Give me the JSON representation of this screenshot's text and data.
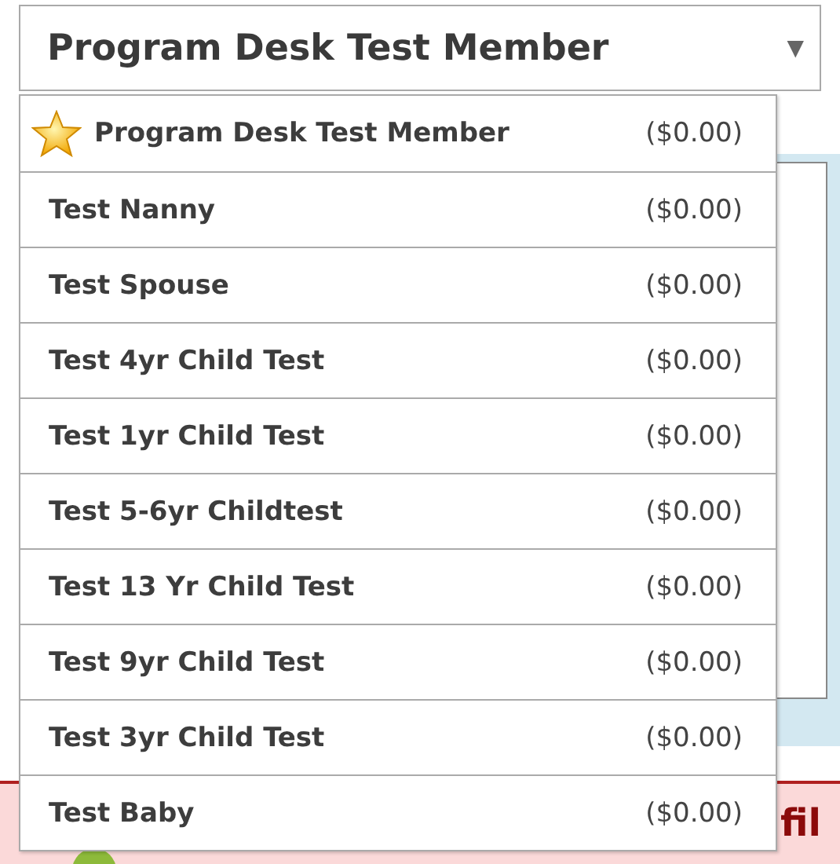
{
  "member_select": {
    "value": "Program Desk Test Member",
    "arrow": "▼"
  },
  "options": [
    {
      "name": "Program Desk Test Member",
      "amount": "($0.00)",
      "starred": true
    },
    {
      "name": "Test Nanny",
      "amount": "($0.00)",
      "starred": false
    },
    {
      "name": "Test Spouse",
      "amount": "($0.00)",
      "starred": false
    },
    {
      "name": "Test 4yr Child Test",
      "amount": "($0.00)",
      "starred": false
    },
    {
      "name": "Test 1yr Child Test",
      "amount": "($0.00)",
      "starred": false
    },
    {
      "name": "Test 5-6yr Childtest",
      "amount": "($0.00)",
      "starred": false
    },
    {
      "name": "Test 13 Yr Child Test",
      "amount": "($0.00)",
      "starred": false
    },
    {
      "name": "Test 9yr Child Test",
      "amount": "($0.00)",
      "starred": false
    },
    {
      "name": "Test 3yr Child Test",
      "amount": "($0.00)",
      "starred": false
    },
    {
      "name": "Test Baby",
      "amount": "($0.00)",
      "starred": false
    }
  ],
  "alert": {
    "text": "fil"
  }
}
